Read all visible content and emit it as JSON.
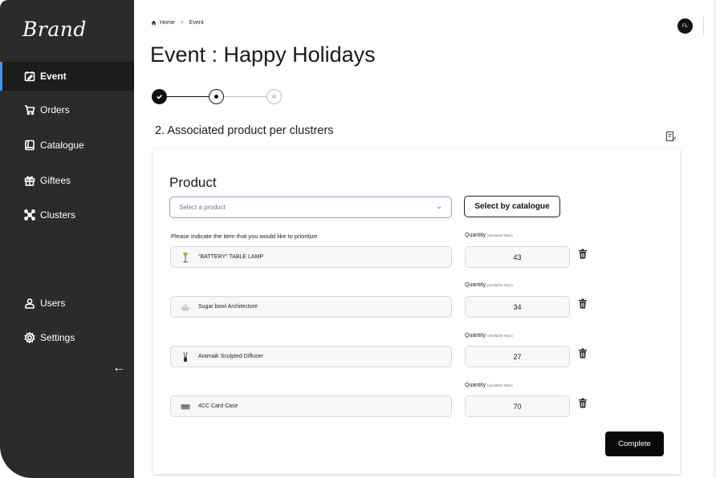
{
  "sidebar": {
    "brand": "Brand",
    "items": [
      {
        "label": "Event",
        "icon": "calendar-edit-icon",
        "active": true
      },
      {
        "label": "Orders",
        "icon": "cart-icon"
      },
      {
        "label": "Catalogue",
        "icon": "book-icon"
      },
      {
        "label": "Giftees",
        "icon": "gift-icon"
      },
      {
        "label": "Clusters",
        "icon": "clusters-icon"
      }
    ],
    "bottom_items": [
      {
        "label": "Users",
        "icon": "user-icon"
      },
      {
        "label": "Settings",
        "icon": "gear-icon"
      }
    ],
    "collapse": "←"
  },
  "header": {
    "breadcrumb": [
      "Home",
      "Event"
    ],
    "breadcrumb_sep": ">",
    "title": "Event : Happy Holidays",
    "avatar_initials": "FL"
  },
  "stepper": {
    "current_step": 2,
    "total_steps": 3
  },
  "section": {
    "title": "2. Associated product per clustrers"
  },
  "card": {
    "title": "Product",
    "select_placeholder": "Select a product",
    "catalogue_button": "Select by catalogue",
    "prioritize_label": "Please indicate the item that you would like to prioritize",
    "qty_label": "Quantity",
    "qty_available": "(available 90pz)",
    "items": [
      {
        "name": "\"BATTERY\" TABLE LAMP",
        "qty": "43",
        "thumb": "lamp-thumbnail"
      },
      {
        "name": "Sugar bowl Architecture",
        "qty": "34",
        "thumb": "sugar-bowl-thumbnail"
      },
      {
        "name": "Aramaik Sculpted Diffuser",
        "qty": "27",
        "thumb": "diffuser-thumbnail"
      },
      {
        "name": "4CC Card Case",
        "qty": "70",
        "thumb": "card-case-thumbnail"
      }
    ],
    "complete_button": "Complete"
  },
  "colors": {
    "sidebar_bg": "#2b2b2b",
    "active_bg": "#1c1c1c",
    "active_accent": "#4a90e2",
    "select_border": "#8aa8e0"
  }
}
